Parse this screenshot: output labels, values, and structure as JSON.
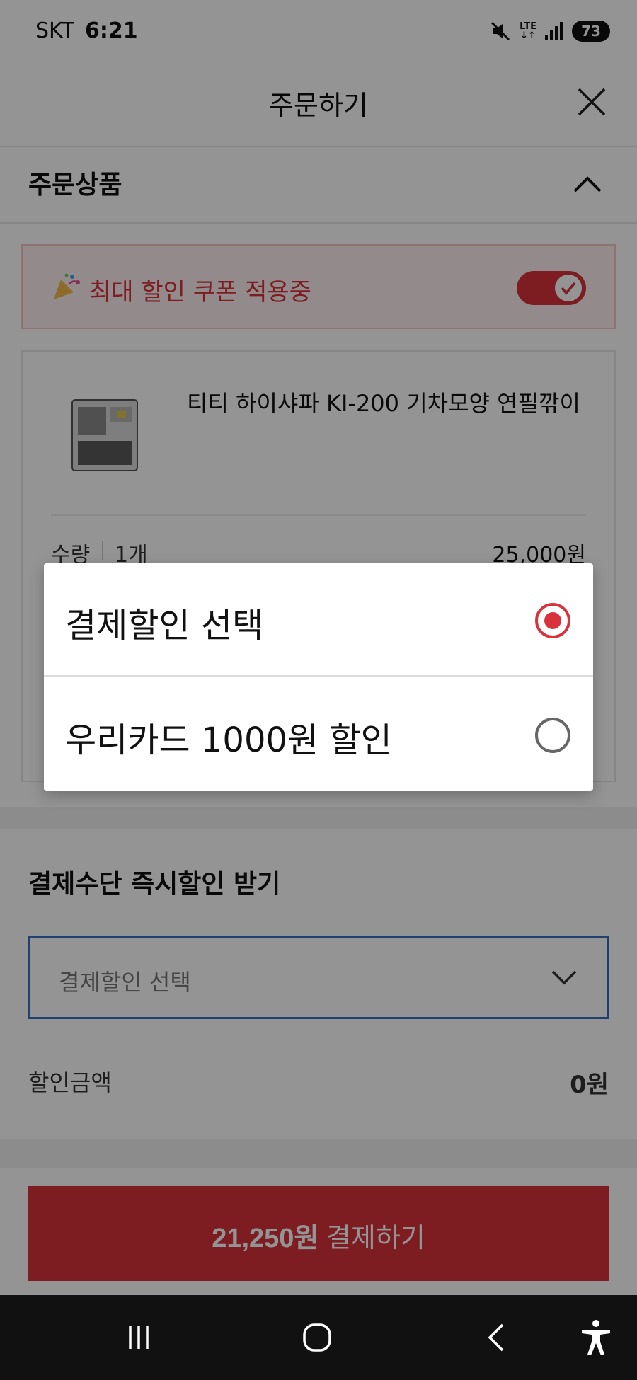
{
  "status_bar": {
    "carrier": "SKT",
    "time": "6:21",
    "network": "LTE",
    "battery": "73",
    "icons": [
      "mute-icon",
      "lte-icon",
      "signal-icon",
      "battery-icon"
    ]
  },
  "header": {
    "title": "주문하기",
    "close_icon": "close-icon"
  },
  "order_section": {
    "title": "주문상품",
    "collapse_icon": "chevron-up-icon",
    "coupon_banner": {
      "icon": "party-popper-icon",
      "text": "최대 할인 쿠폰 적용중",
      "toggle_on": true
    },
    "product": {
      "name": "티티 하이샤파 KI-200 기차모양 연필깎이",
      "quantity_label": "수량",
      "quantity": "1개",
      "price": "25,000원"
    }
  },
  "pay_discount": {
    "title": "결제수단 즉시할인 받기",
    "select_value": "결제할인 선택",
    "chevron_icon": "chevron-down-icon",
    "discount_label": "할인금액",
    "discount_value": "0원"
  },
  "pay_button": {
    "amount": "21,250원",
    "label": " 결제하기"
  },
  "dialog": {
    "options": [
      {
        "label": "결제할인 선택",
        "selected": true
      },
      {
        "label": "우리카드 1000원 할인",
        "selected": false
      }
    ]
  },
  "nav_bar": {
    "buttons": [
      "recent-apps-icon",
      "home-icon",
      "back-icon",
      "accessibility-icon"
    ]
  },
  "colors": {
    "accent": "#d8323c",
    "select_border": "#3a6fc4",
    "nav_bar": "#111111"
  }
}
